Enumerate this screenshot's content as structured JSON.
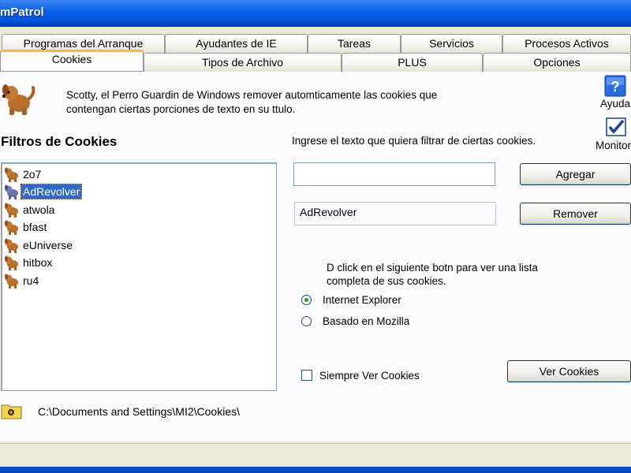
{
  "window": {
    "title": "mPatrol"
  },
  "tabs_back": [
    {
      "label": "Programas del Arranque"
    },
    {
      "label": "Ayudantes de IE"
    },
    {
      "label": "Tareas"
    },
    {
      "label": "Servicios"
    },
    {
      "label": "Procesos Activos"
    }
  ],
  "tabs_front": [
    {
      "label": "Cookies",
      "active": true
    },
    {
      "label": "Tipos de Archivo"
    },
    {
      "label": "PLUS"
    },
    {
      "label": "Opciones"
    }
  ],
  "header": {
    "description": "Scotty, el Perro Guardin de Windows remover automticamente las cookies que contengan ciertas porciones de texto en su ttulo.",
    "help_label": "Ayuda",
    "monitor_label": "Monitor"
  },
  "filters": {
    "title": "Filtros de Cookies",
    "instruction": "Ingrese el texto que quiera filtrar de ciertas cookies.",
    "items": [
      {
        "label": "2o7"
      },
      {
        "label": "AdRevolver",
        "selected": true
      },
      {
        "label": "atwola"
      },
      {
        "label": "bfast"
      },
      {
        "label": "eUniverse"
      },
      {
        "label": "hitbox"
      },
      {
        "label": "ru4"
      }
    ],
    "new_filter_value": "",
    "selected_filter_value": "AdRevolver",
    "add_label": "Agregar",
    "remove_label": "Remover"
  },
  "viewer": {
    "prompt": "D click en el siguiente botn para ver una lista completa de sus cookies.",
    "browser_options": [
      {
        "label": "Internet Explorer",
        "selected": true
      },
      {
        "label": "Basado en Mozilla",
        "selected": false
      }
    ],
    "always_view_label": "Siempre Ver Cookies",
    "always_view_checked": false,
    "view_button_label": "Ver Cookies"
  },
  "footer": {
    "cookies_path": "C:\\Documents and Settings\\MI2\\Cookies\\"
  }
}
